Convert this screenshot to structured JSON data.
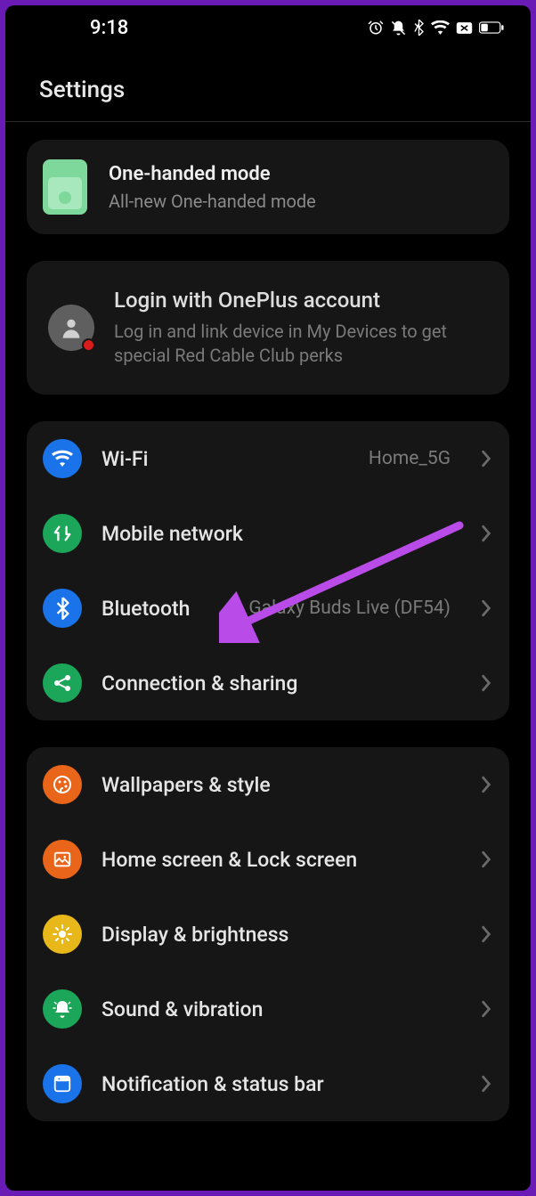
{
  "status": {
    "time": "9:18"
  },
  "page": {
    "title": "Settings"
  },
  "promo": {
    "title": "One-handed mode",
    "subtitle": "All-new One-handed mode"
  },
  "account": {
    "title": "Login with OnePlus account",
    "subtitle": "Log in and link device in My Devices to get special Red Cable Club perks"
  },
  "conn_group": [
    {
      "label": "Wi-Fi",
      "value": "Home_5G"
    },
    {
      "label": "Mobile network",
      "value": ""
    },
    {
      "label": "Bluetooth",
      "value": "Galaxy Buds Live (DF54)"
    },
    {
      "label": "Connection & sharing",
      "value": ""
    }
  ],
  "display_group": [
    {
      "label": "Wallpapers & style"
    },
    {
      "label": "Home screen & Lock screen"
    },
    {
      "label": "Display & brightness"
    },
    {
      "label": "Sound & vibration"
    },
    {
      "label": "Notification & status bar"
    }
  ]
}
